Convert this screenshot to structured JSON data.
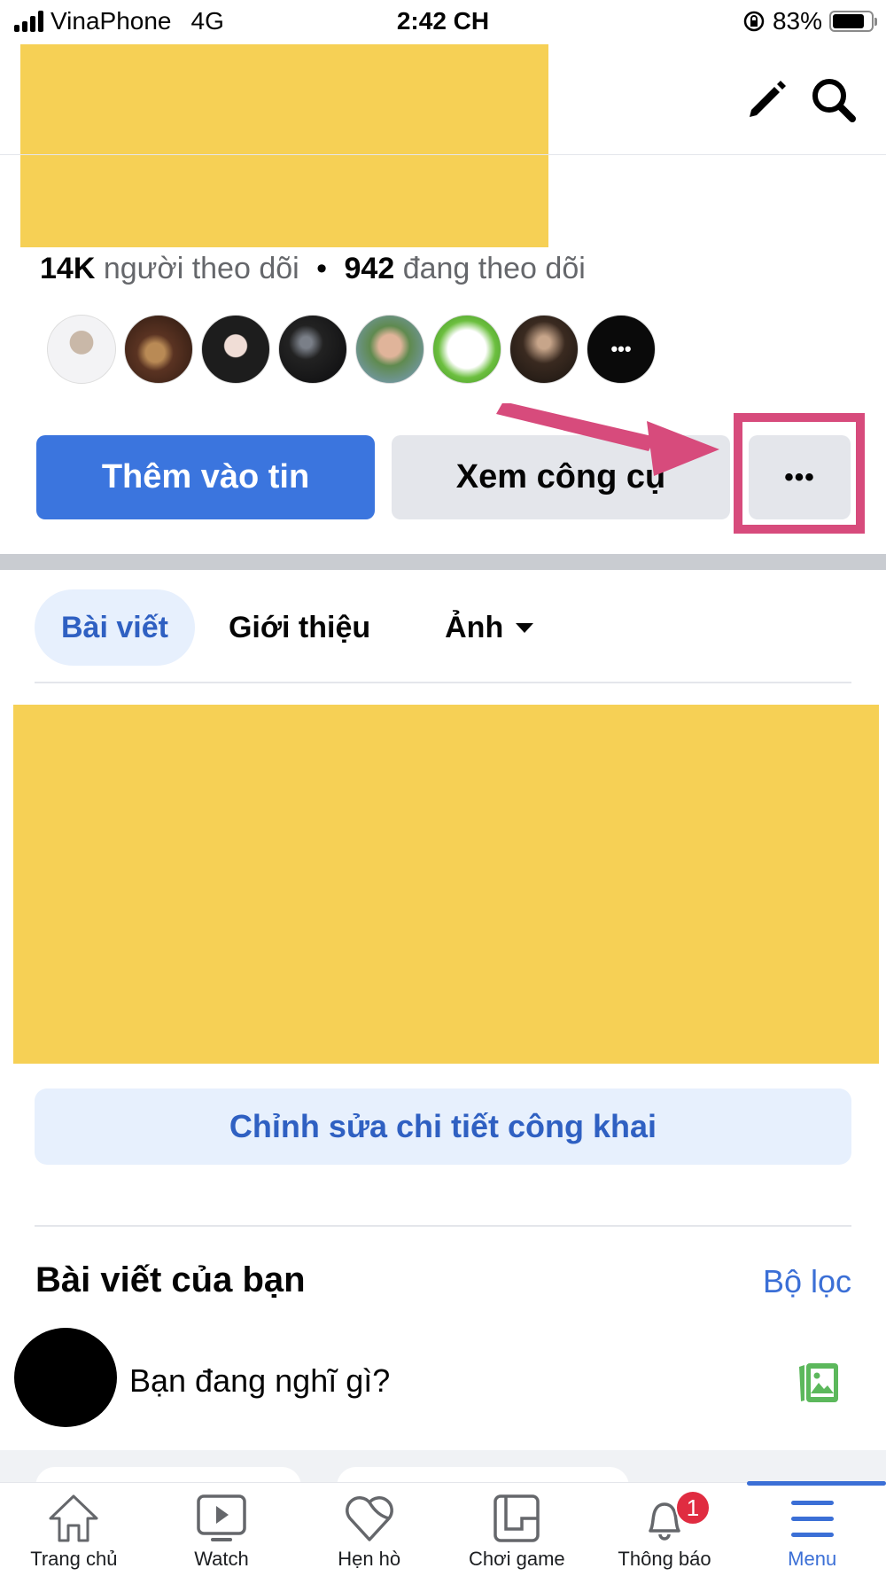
{
  "status_bar": {
    "carrier": "VinaPhone",
    "network": "4G",
    "time": "2:42 CH",
    "battery_percent_label": "83%",
    "battery_level": 0.83,
    "icons": [
      "signal-icon",
      "rotation-lock-icon",
      "battery-icon"
    ]
  },
  "header": {
    "icons": [
      "pencil-icon",
      "search-icon"
    ]
  },
  "profile": {
    "followers_count": "14K",
    "followers_label": "người theo dõi",
    "separator": "•",
    "following_count": "942",
    "following_label": "đang theo dõi",
    "follower_avatars_count": 7,
    "more_avatars_label": "•••"
  },
  "actions": {
    "add_to_story": "Thêm vào tin",
    "view_tools": "Xem công cụ",
    "more": "•••"
  },
  "annotation": {
    "highlight_color": "#d74b7c"
  },
  "tabs": [
    {
      "label": "Bài viết",
      "active": true
    },
    {
      "label": "Giới thiệu",
      "active": false
    },
    {
      "label": "Ảnh",
      "active": false,
      "dropdown": true
    }
  ],
  "edit_details_button": "Chỉnh sửa chi tiết công khai",
  "posts": {
    "title": "Bài viết của bạn",
    "filter": "Bộ lọc",
    "composer_placeholder": "Bạn đang nghĩ gì?"
  },
  "bottom_nav": [
    {
      "label": "Trang chủ",
      "icon": "home-icon"
    },
    {
      "label": "Watch",
      "icon": "watch-icon"
    },
    {
      "label": "Hẹn hò",
      "icon": "dating-heart-icon"
    },
    {
      "label": "Chơi game",
      "icon": "gaming-icon"
    },
    {
      "label": "Thông báo",
      "icon": "bell-icon",
      "badge": "1"
    },
    {
      "label": "Menu",
      "icon": "menu-icon",
      "active": true
    }
  ],
  "colors": {
    "primary_blue": "#3b75de",
    "link_blue": "#2f60c2",
    "redaction_yellow": "#f6d055",
    "badge_red": "#e02c41"
  }
}
